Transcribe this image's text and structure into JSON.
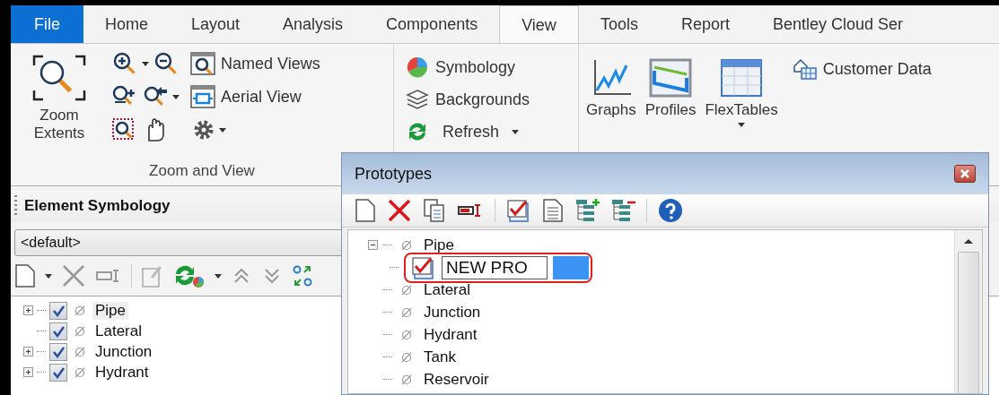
{
  "tabs": [
    {
      "label": "File",
      "kind": "file",
      "selected": false
    },
    {
      "label": "Home",
      "kind": "tab",
      "selected": false
    },
    {
      "label": "Layout",
      "kind": "tab",
      "selected": false
    },
    {
      "label": "Analysis",
      "kind": "tab",
      "selected": false
    },
    {
      "label": "Components",
      "kind": "tab",
      "selected": false
    },
    {
      "label": "View",
      "kind": "tab",
      "selected": true
    },
    {
      "label": "Tools",
      "kind": "tab",
      "selected": false
    },
    {
      "label": "Report",
      "kind": "tab",
      "selected": false
    },
    {
      "label": "Bentley Cloud Ser",
      "kind": "tab",
      "selected": false
    }
  ],
  "ribbon": {
    "zoom_group": {
      "label": "Zoom and View",
      "zoom_extents": "Zoom Extents",
      "named_views": "Named Views",
      "aerial_view": "Aerial View"
    },
    "display_group": {
      "symbology": "Symbology",
      "backgrounds": "Backgrounds",
      "refresh": "Refresh"
    },
    "view_group": {
      "graphs": "Graphs",
      "profiles": "Profiles",
      "flextables": "FlexTables",
      "customer_data": "Customer Data"
    }
  },
  "element_symbology": {
    "title": "Element Symbology",
    "dropdown": {
      "value": "<default>"
    },
    "items": [
      {
        "label": "Pipe",
        "kind": "group",
        "expanded": false,
        "checked": true,
        "selected": true
      },
      {
        "label": "Lateral",
        "kind": "leaf",
        "checked": true,
        "selected": false
      },
      {
        "label": "Junction",
        "kind": "group",
        "expanded": false,
        "checked": true,
        "selected": false
      },
      {
        "label": "Hydrant",
        "kind": "group",
        "expanded": false,
        "checked": true,
        "selected": false
      }
    ]
  },
  "prototypes": {
    "title": "Prototypes",
    "items": [
      {
        "label": "Pipe",
        "kind": "group",
        "expanded": true,
        "children": [
          {
            "label": "NEW PRO",
            "editing": true
          }
        ]
      },
      {
        "label": "Lateral",
        "kind": "leaf"
      },
      {
        "label": "Junction",
        "kind": "leaf"
      },
      {
        "label": "Hydrant",
        "kind": "leaf"
      },
      {
        "label": "Tank",
        "kind": "leaf"
      },
      {
        "label": "Reservoir",
        "kind": "leaf"
      }
    ]
  }
}
